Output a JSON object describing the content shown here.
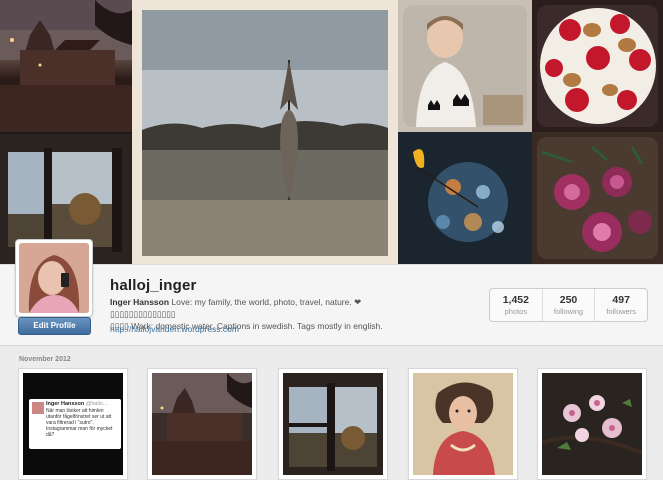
{
  "profile": {
    "username": "halloj_inger",
    "full_name": "Inger Hansson",
    "bio_line1": " Love: my family, the world, photo, travel, nature. ❤︎▯▯▯▯▯▯▯▯▯▯▯▯▯▯",
    "bio_line2": "▯▯▯▯ Work: domestic water. Captions in swedish. Tags mostly in english.",
    "website": "http://hallojvariden.wordpress.com",
    "edit_button": "Edit Profile"
  },
  "stats": [
    {
      "value": "1,452",
      "label": "photos"
    },
    {
      "value": "250",
      "label": "following"
    },
    {
      "value": "497",
      "label": "followers"
    }
  ],
  "feed": {
    "month_label": "November 2012",
    "tweet": {
      "name": "Inger Hansson",
      "handle": "@hallo...",
      "text": "När man tänker att himlen utanför fågelfönstret ser ut att vara filtrerad i \"sutro\". Instagrammar man för mycket då?"
    }
  },
  "colors": {
    "accent": "#3f729b",
    "button": "#3f6c9f",
    "background": "#ececec"
  }
}
